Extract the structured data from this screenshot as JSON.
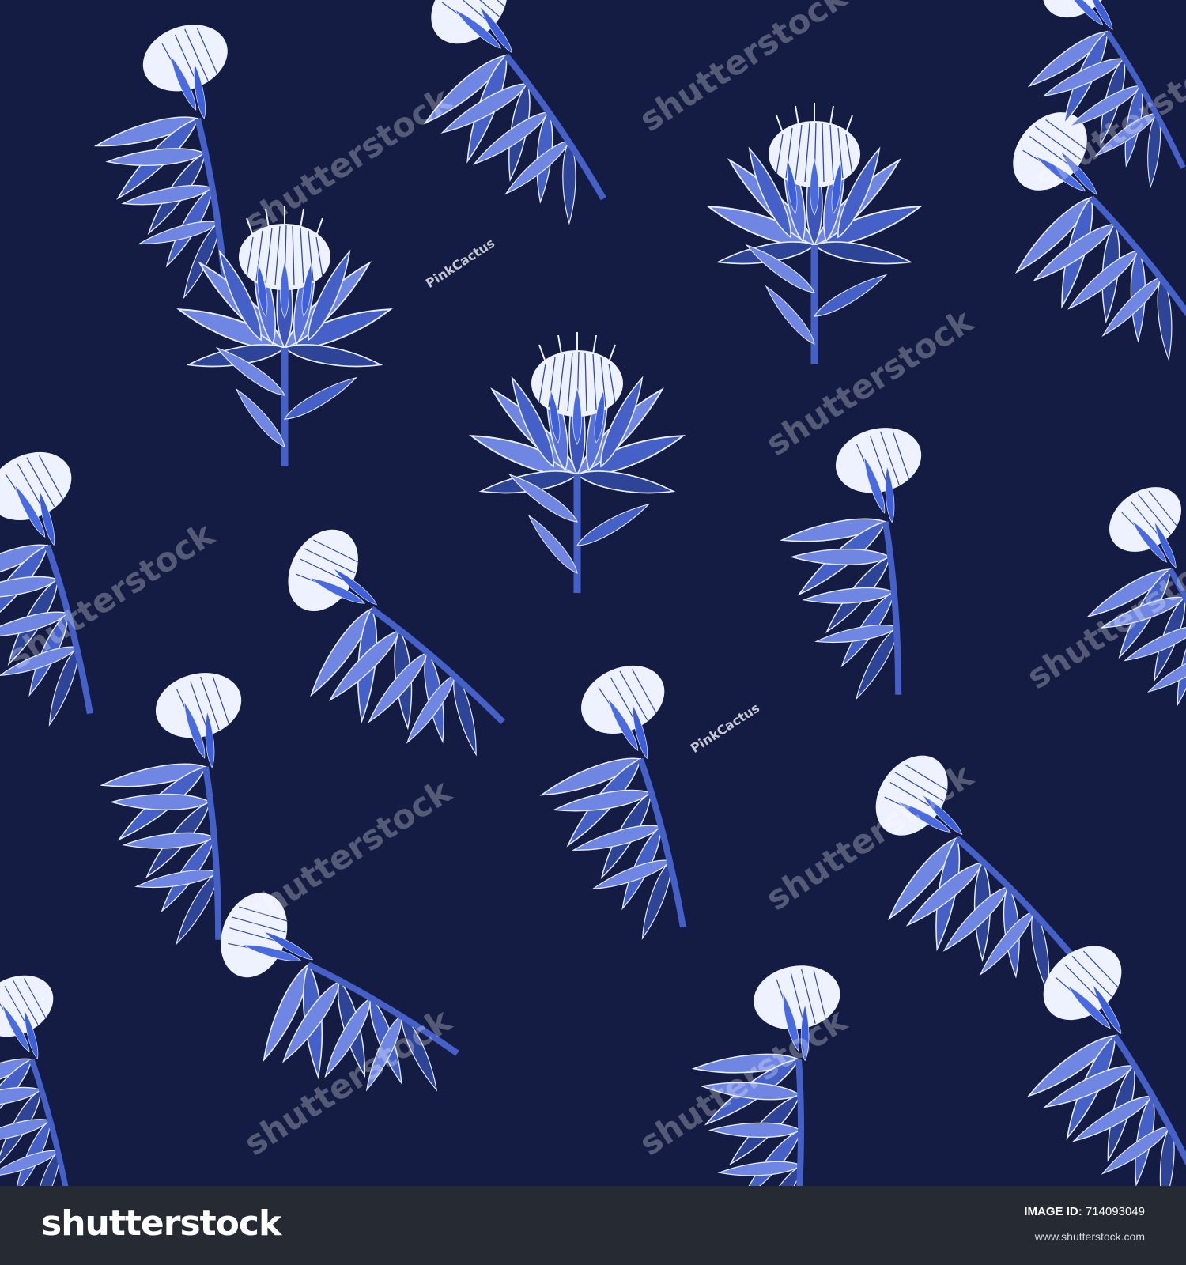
{
  "image": {
    "subject": "seamless protea flower pattern",
    "background_color": "#141c43",
    "leaf_colors": [
      "#6f86e3",
      "#4560c7",
      "#2e4497"
    ],
    "outline_color": "#e8eeff"
  },
  "watermark": {
    "brand": "shutterstock",
    "contributor": "PinkCactus",
    "brand_icon": "shutterstock-logo-icon"
  },
  "footer": {
    "logo_text": "shutterstock",
    "image_id_label": "IMAGE ID:",
    "image_id_value": "714093049",
    "url": "www.shutterstock.com",
    "background_color": "#262b33"
  }
}
